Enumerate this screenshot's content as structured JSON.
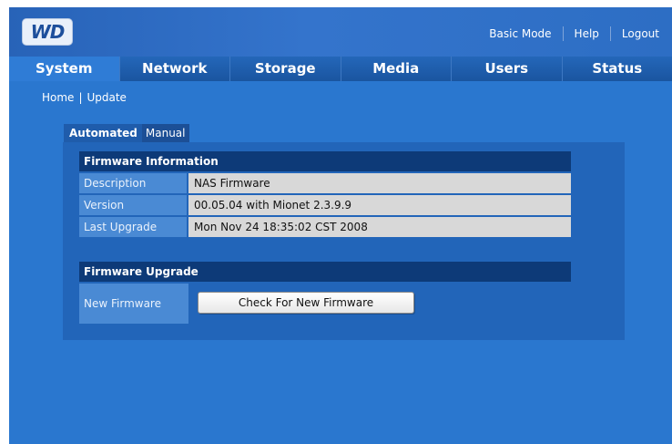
{
  "brand": {
    "logo_text": "WD"
  },
  "toplinks": {
    "basic_mode": "Basic Mode",
    "help": "Help",
    "logout": "Logout"
  },
  "nav": {
    "tabs": [
      {
        "label": "System",
        "active": true
      },
      {
        "label": "Network",
        "active": false
      },
      {
        "label": "Storage",
        "active": false
      },
      {
        "label": "Media",
        "active": false
      },
      {
        "label": "Users",
        "active": false
      },
      {
        "label": "Status",
        "active": false
      }
    ]
  },
  "breadcrumb": {
    "home": "Home",
    "separator": "|",
    "current": "Update"
  },
  "subtabs": {
    "automated": "Automated",
    "manual": "Manual"
  },
  "firmware_info": {
    "heading": "Firmware Information",
    "rows": [
      {
        "label": "Description",
        "value": "NAS Firmware"
      },
      {
        "label": "Version",
        "value": "00.05.04 with Mionet 2.3.9.9"
      },
      {
        "label": "Last Upgrade",
        "value": "Mon Nov 24 18:35:02 CST 2008"
      }
    ]
  },
  "firmware_upgrade": {
    "heading": "Firmware Upgrade",
    "label": "New Firmware",
    "button": "Check For New Firmware"
  },
  "colors": {
    "background": "#2a77cf",
    "nav": "#1d5aa8",
    "section_header": "#0d3a78",
    "value_cell": "#d8d8d8"
  }
}
